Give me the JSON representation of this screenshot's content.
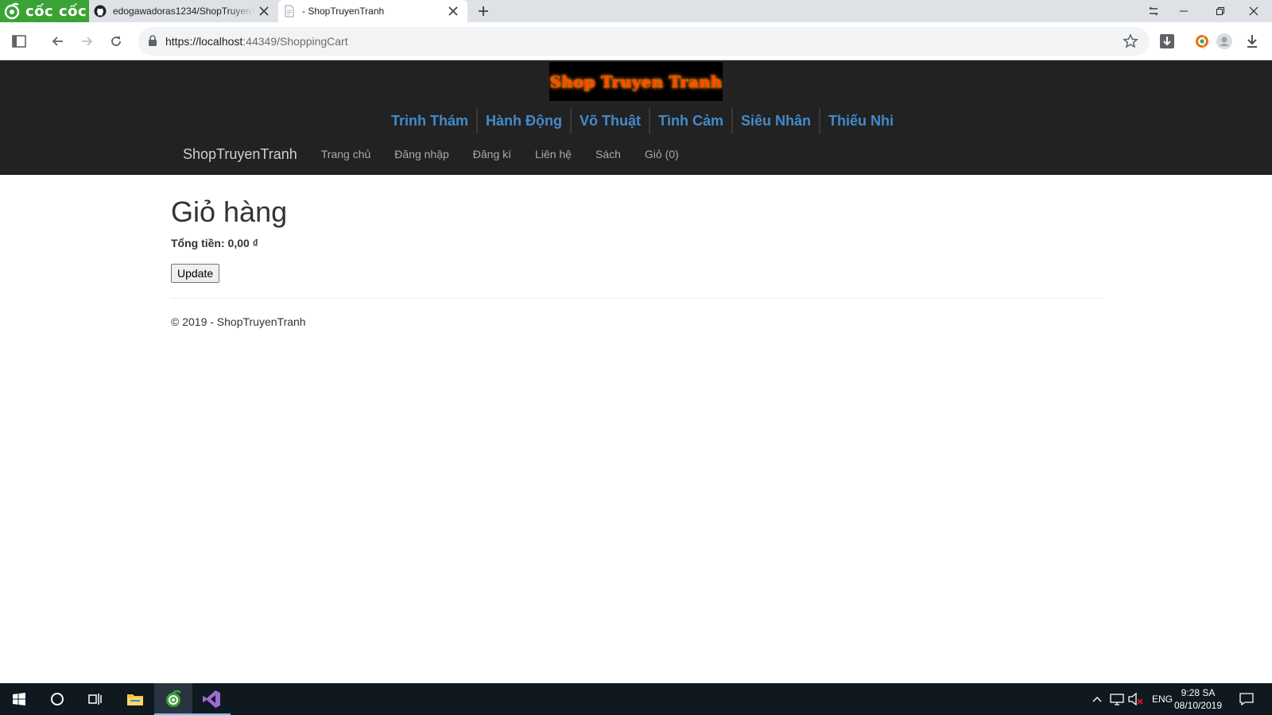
{
  "browser": {
    "brand": "cốc cốc",
    "tabs": [
      {
        "title": "edogawadoras1234/ShopTruyenTranh",
        "icon": "github-icon"
      },
      {
        "title": "- ShopTruyenTranh",
        "icon": "page-icon"
      }
    ],
    "url": {
      "host": "https://localhost",
      "rest": ":44349/ShoppingCart"
    }
  },
  "site": {
    "logo_text": "Shop Truyen Tranh",
    "categories": [
      "Trinh Thám",
      "Hành Động",
      "Võ Thuật",
      "Tình Cảm",
      "Siêu Nhân",
      "Thiếu Nhi"
    ],
    "brand": "ShopTruyenTranh",
    "nav": [
      "Trang chủ",
      "Đăng nhập",
      "Đăng kí",
      "Liên hệ",
      "Sách",
      "Giỏ (0)"
    ]
  },
  "page": {
    "title": "Giỏ hàng",
    "total_label": "Tổng tiền: 0,00 ₫",
    "update_label": "Update",
    "footer": "© 2019 - ShopTruyenTranh"
  },
  "taskbar": {
    "language": "ENG",
    "time": "9:28 SA",
    "date": "08/10/2019"
  },
  "colors": {
    "accent_link": "#428bca",
    "header_bg": "#222222",
    "brand_green": "#3aa335"
  }
}
